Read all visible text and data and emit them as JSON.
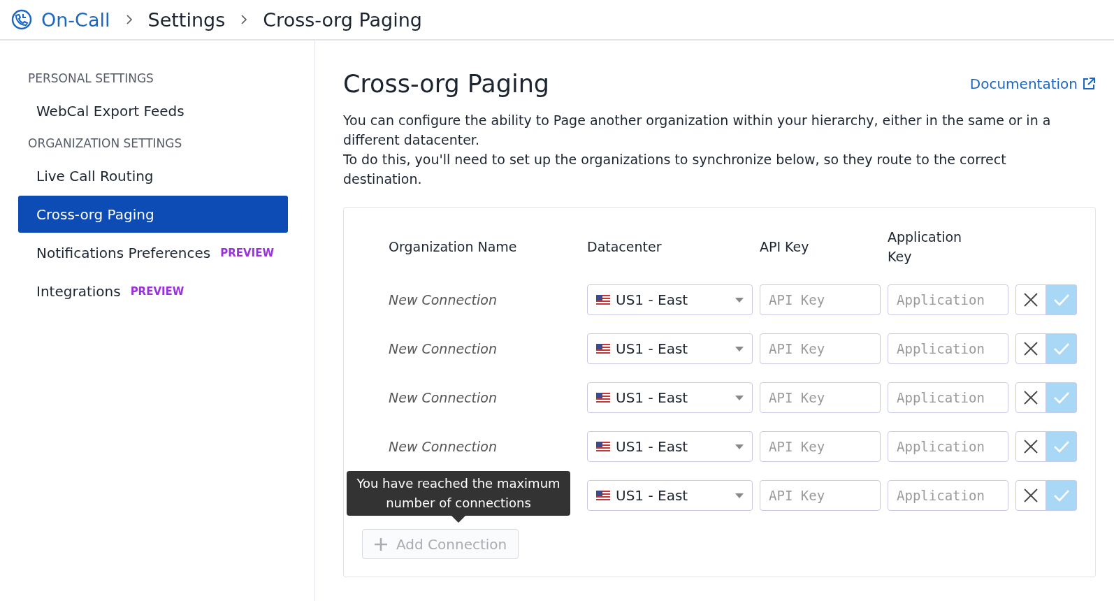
{
  "breadcrumb": [
    {
      "label": "On-Call",
      "kind": "link"
    },
    {
      "label": "Settings",
      "kind": "text"
    },
    {
      "label": "Cross-org Paging",
      "kind": "text"
    }
  ],
  "sidebar": {
    "sections": [
      {
        "heading": "PERSONAL SETTINGS",
        "items": [
          {
            "label": "WebCal Export Feeds",
            "selected": false
          }
        ]
      },
      {
        "heading": "ORGANIZATION SETTINGS",
        "items": [
          {
            "label": "Live Call Routing",
            "selected": false
          },
          {
            "label": "Cross-org Paging",
            "selected": true
          },
          {
            "label": "Notifications Preferences",
            "selected": false,
            "badge": "PREVIEW"
          },
          {
            "label": "Integrations",
            "selected": false,
            "badge": "PREVIEW"
          }
        ]
      }
    ]
  },
  "page": {
    "title": "Cross-org Paging",
    "documentation_link": "Documentation",
    "paragraphs": [
      "You can configure the ability to Page another organization within your hierarchy, either in the same or in a different datacenter.",
      "To do this, you'll need to set up the organizations to synchronize below, so they route to the correct destination."
    ]
  },
  "table": {
    "columns": [
      "Organization Name",
      "Datacenter",
      "API Key",
      "Application Key"
    ],
    "rows": [
      {
        "name": "New Connection",
        "datacenter": "US1 - East",
        "api_key_placeholder": "API Key",
        "app_key_placeholder": "Application",
        "confirm_disabled": true
      },
      {
        "name": "New Connection",
        "datacenter": "US1 - East",
        "api_key_placeholder": "API Key",
        "app_key_placeholder": "Application",
        "confirm_disabled": true
      },
      {
        "name": "New Connection",
        "datacenter": "US1 - East",
        "api_key_placeholder": "API Key",
        "app_key_placeholder": "Application",
        "confirm_disabled": true
      },
      {
        "name": "New Connection",
        "datacenter": "US1 - East",
        "api_key_placeholder": "API Key",
        "app_key_placeholder": "Application",
        "confirm_disabled": true
      },
      {
        "datacenter": "US1 - East",
        "api_key_placeholder": "API Key",
        "app_key_placeholder": "Application",
        "confirm_disabled": true
      }
    ],
    "add_button": {
      "label": "Add Connection",
      "disabled": true
    },
    "tooltip": "You have reached the maximum number of connections"
  }
}
